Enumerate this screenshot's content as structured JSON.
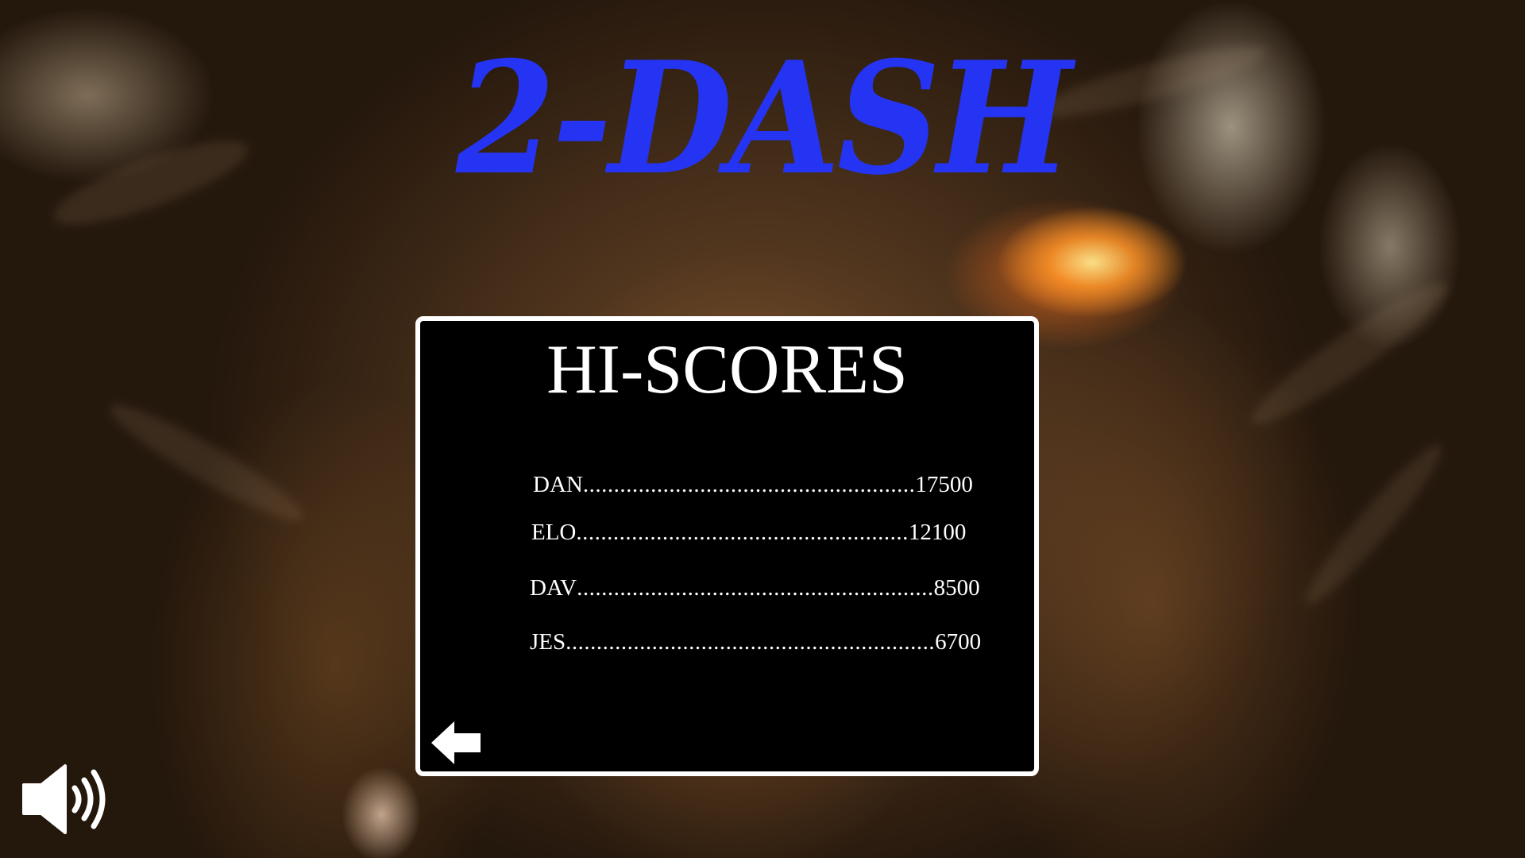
{
  "game": {
    "title": "2-DASH"
  },
  "hiscores": {
    "heading": "HI-SCORES",
    "entries": [
      {
        "name": "DAN",
        "dots": "......................................................",
        "score": "17500"
      },
      {
        "name": "ELO",
        "dots": "......................................................",
        "score": "12100"
      },
      {
        "name": "DAV",
        "dots": "..........................................................",
        "score": "8500"
      },
      {
        "name": "JES",
        "dots": "............................................................",
        "score": "6700"
      }
    ]
  },
  "controls": {
    "back_icon": "arrow-left-icon",
    "sound_icon": "speaker-volume-icon"
  },
  "colors": {
    "title": "#2534f3",
    "panel_background": "#000000",
    "panel_border": "#ffffff",
    "text": "#ffffff"
  }
}
